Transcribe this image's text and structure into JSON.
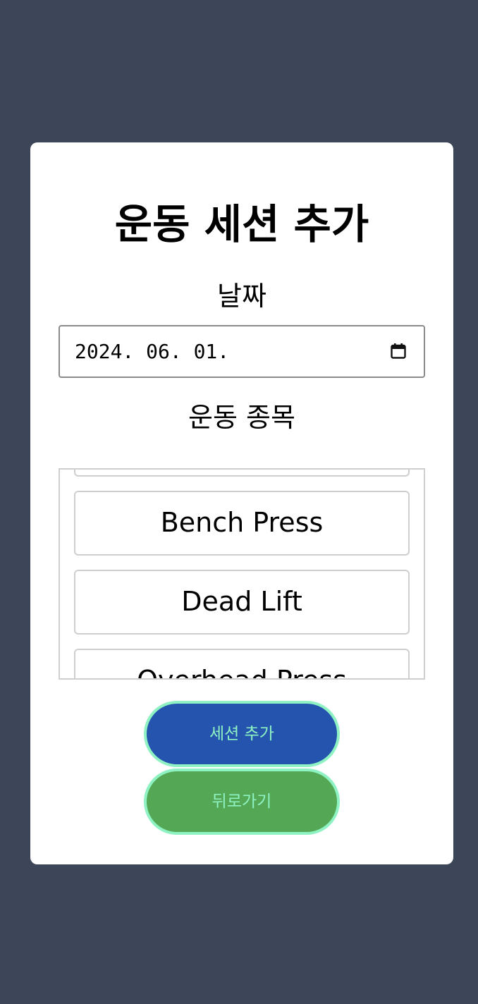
{
  "page": {
    "title": "운동 세션 추가",
    "date_label": "날짜",
    "date_value": "2024. 06. 01.",
    "exercise_label": "운동 종목"
  },
  "exercises": [
    {
      "label": ""
    },
    {
      "label": "Bench Press"
    },
    {
      "label": "Dead Lift"
    },
    {
      "label": "Overhead Press"
    }
  ],
  "actions": {
    "add_session": "세션 추가",
    "back": "뒤로가기"
  },
  "colors": {
    "background": "#3d4659",
    "card": "#ffffff",
    "add_button": "#2454ad",
    "back_button": "#54a855",
    "button_border_text": "#8ef2c3"
  },
  "icons": {
    "date_picker": "calendar-icon"
  }
}
